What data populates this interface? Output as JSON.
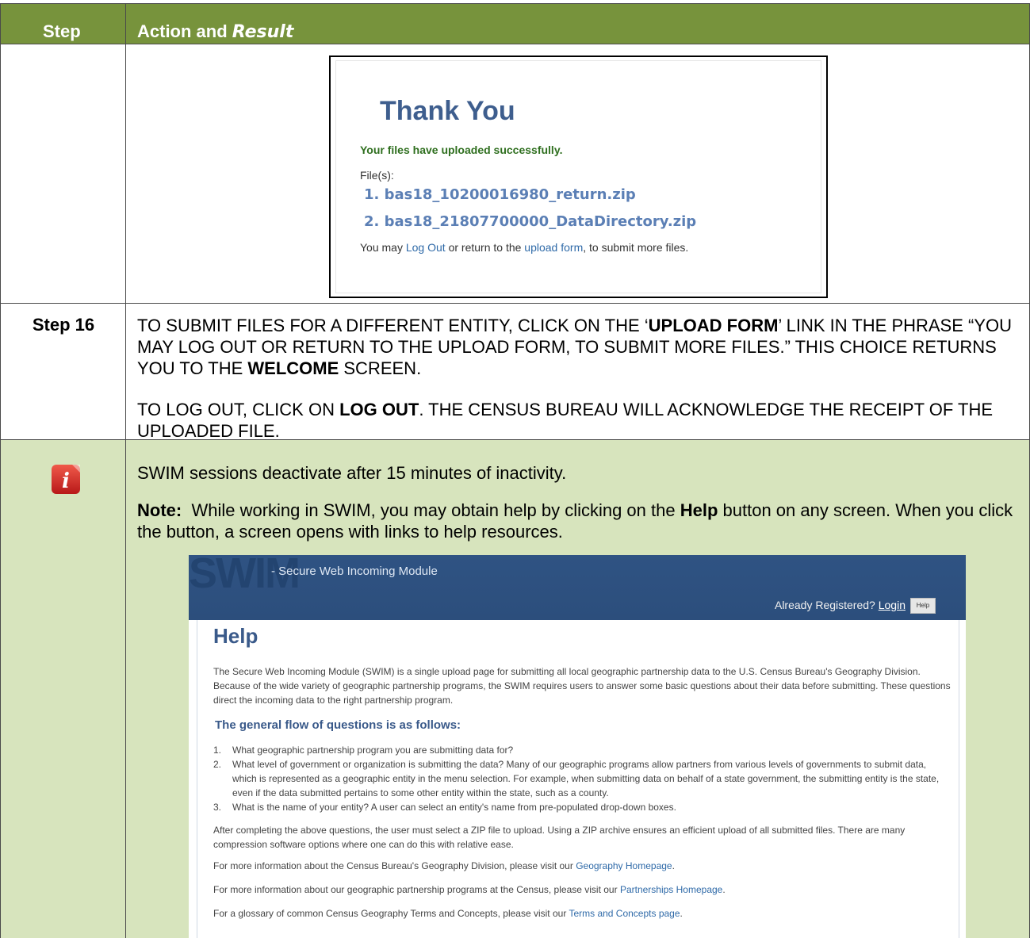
{
  "header": {
    "step": "Step",
    "action": "Action and ",
    "result": "Result"
  },
  "thank_you": {
    "title": "Thank You",
    "success": "Your files have uploaded successfully.",
    "files_label": "File(s):",
    "files": [
      "1. bas18_10200016980_return.zip",
      "2. bas18_21807700000_DataDirectory.zip"
    ],
    "footer_pre": "You may ",
    "footer_logout": "Log Out",
    "footer_mid": " or return to the ",
    "footer_upload": "upload form",
    "footer_post": ", to submit more files."
  },
  "step16": {
    "label": "Step 16",
    "p1_a": "TO SUBMIT FILES FOR A DIFFERENT ENTITY, CLICK ON THE ‘",
    "p1_b": "UPLOAD FORM",
    "p1_c": "’ LINK IN THE PHRASE “YOU MAY LOG OUT OR RETURN TO THE UPLOAD FORM, TO SUBMIT MORE FILES.” THIS CHOICE RETURNS YOU TO THE ",
    "p1_d": "WELCOME",
    "p1_e": " SCREEN.",
    "p2_a": "TO LOG OUT, CLICK ON ",
    "p2_b": "LOG OUT",
    "p2_c": ". THE CENSUS BUREAU WILL ACKNOWLEDGE THE RECEIPT OF THE UPLOADED FILE."
  },
  "note": {
    "icon": "info-icon",
    "line1": "SWIM sessions deactivate after 15 minutes of inactivity.",
    "note_label": "Note:",
    "line2_a": "  While working in SWIM, you may obtain help by clicking on the ",
    "line2_b": "Help",
    "line2_c": " button on any screen. When you click the button, a screen opens with links to help resources."
  },
  "help_page": {
    "logo": "SWIM",
    "subtitle": "- Secure Web Incoming Module",
    "registered": "Already Registered? ",
    "login": "Login",
    "help_button": "Help",
    "title": "Help",
    "intro": "The Secure Web Incoming Module (SWIM) is a single upload page for submitting all local geographic partnership data to the U.S. Census Bureau's Geography Division. Because of the wide variety of geographic partnership programs, the SWIM requires users to answer some basic questions about their data before submitting. These questions direct the incoming data to the right partnership program.",
    "flow_title": "The general flow of questions is as follows:",
    "questions": [
      {
        "num": "1.",
        "text": "What geographic partnership program you are submitting data for?"
      },
      {
        "num": "2.",
        "text": "What level of government or organization is submitting the data? Many of our geographic programs allow partners from various levels of governments to submit data, which is represented as a geographic entity in the menu selection. For example, when submitting data on behalf of a state government, the submitting entity is the state, even if the data submitted pertains to some other entity within the state, such as a county."
      },
      {
        "num": "3.",
        "text": "What is the name of your entity? A user can select an entity's name from pre-populated drop-down boxes."
      }
    ],
    "after": "After completing the above questions, the user must select a ZIP file to upload. Using a ZIP archive ensures an efficient upload of all submitted files. There are many compression software options where one can do this with relative ease.",
    "geo_pre": "For more information about the Census Bureau's Geography Division, please visit our ",
    "geo_link": "Geography Homepage",
    "geo_post": ".",
    "part_pre": "For more information about our geographic partnership programs at the Census, please visit our ",
    "part_link": "Partnerships Homepage",
    "part_post": ".",
    "gloss_pre": "For a glossary of common Census Geography Terms and Concepts, please visit our ",
    "gloss_link": "Terms and Concepts page",
    "gloss_post": "."
  }
}
